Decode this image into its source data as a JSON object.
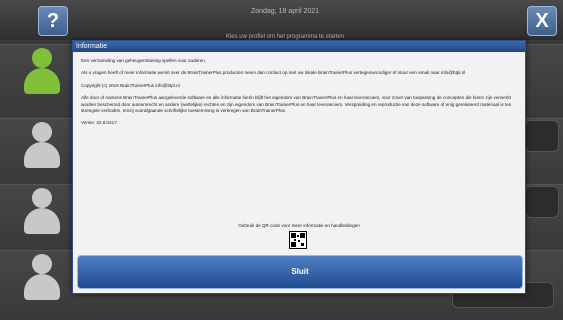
{
  "app": {
    "help_icon": "?",
    "close_icon": "X",
    "top_title": "Zondag, 18 april 2021",
    "top_sub": "Kies uw profiel om het programma te starten"
  },
  "dialog": {
    "title": "Informatie",
    "paragraphs": [
      "Een verzameling van geheugentraining spellen voor ouderen.",
      "Als u vragen heeft of meer informatie wenst over de BrainTrainerPlus producten neem dan contact op met uw lokale BrainTrainerPlus vertegenwoordiger of stuur een email naar info@btpl.nl",
      "Copyright (c) 2016 BrainTrainerPlus info@btpl.nl",
      "Alle door of namens BrainTrainerPlus aangeleverde software en alle informatie hierin blijft het eigendom van BrainTrainerPlus en haar leveranciers, voor zover van toepassing de concepten die hierin zijn verwerkt worden beschermd door auteursrecht en andere (wettelijke) rechten en zijn eigendom van BrainTrainerPlus en haar leveranciers. Verspreiding en reproductie van deze software of enig gerelateerd materiaal is ten strengste verboden, tenzij voorafgaande schriftelijke toestemming is verkregen van BrainTrainerPlus.",
      "Versie: 22.9.0417"
    ],
    "qr_caption": "Gebruik de QR code voor meer informatie en handleidingen",
    "close_label": "Sluit"
  }
}
